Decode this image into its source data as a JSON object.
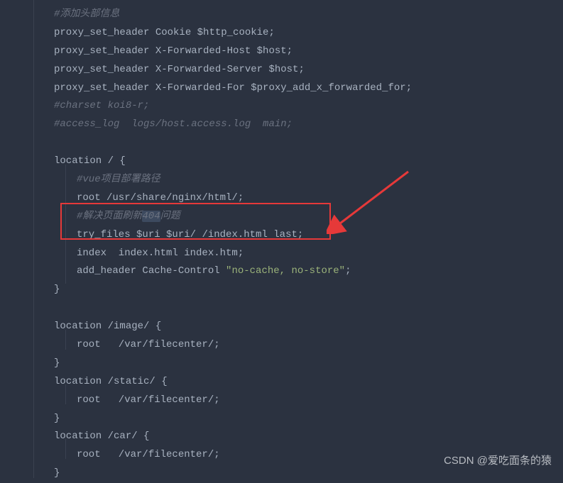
{
  "lines": {
    "l1": "#添加头部信息",
    "l2a": "proxy_set_header Cookie ",
    "l2b": "$http_cookie",
    "l2c": ";",
    "l3a": "proxy_set_header X-Forwarded-Host ",
    "l3b": "$host",
    "l3c": ";",
    "l4a": "proxy_set_header X-Forwarded-Server ",
    "l4b": "$host",
    "l4c": ";",
    "l5a": "proxy_set_header X-Forwarded-For ",
    "l5b": "$proxy_add_x_forwarded_for",
    "l5c": ";",
    "l6": "#charset koi8-r;",
    "l7": "#access_log  logs/host.access.log  main;",
    "l8": "",
    "l9a": "location / ",
    "l9b": "{",
    "l10": "#vue项目部署路径",
    "l11a": "root /usr/share/nginx/html/",
    "l11b": ";",
    "l12a": "#解决页面刷新",
    "l12h": "404",
    "l12b": "问题",
    "l13a": "try_files ",
    "l13b": "$uri",
    "l13c": " ",
    "l13d": "$uri",
    "l13e": "/ /index.html last",
    "l13f": ";",
    "l14a": "index  index.html index.htm",
    "l14b": ";",
    "l15a": "add_header Cache-Control ",
    "l15b": "\"no-cache, no-store\"",
    "l15c": ";",
    "l16": "}",
    "l17": "",
    "l18a": "location /image/ ",
    "l18b": "{",
    "l19a": "root   /var/filecenter/",
    "l19b": ";",
    "l20": "}",
    "l21a": "location /static/ ",
    "l21b": "{",
    "l22a": "root   /var/filecenter/",
    "l22b": ";",
    "l23": "}",
    "l24a": "location /car/ ",
    "l24b": "{",
    "l25a": "root   /var/filecenter/",
    "l25b": ";",
    "l26": "}"
  },
  "watermark": "CSDN @爱吃面条的猿"
}
